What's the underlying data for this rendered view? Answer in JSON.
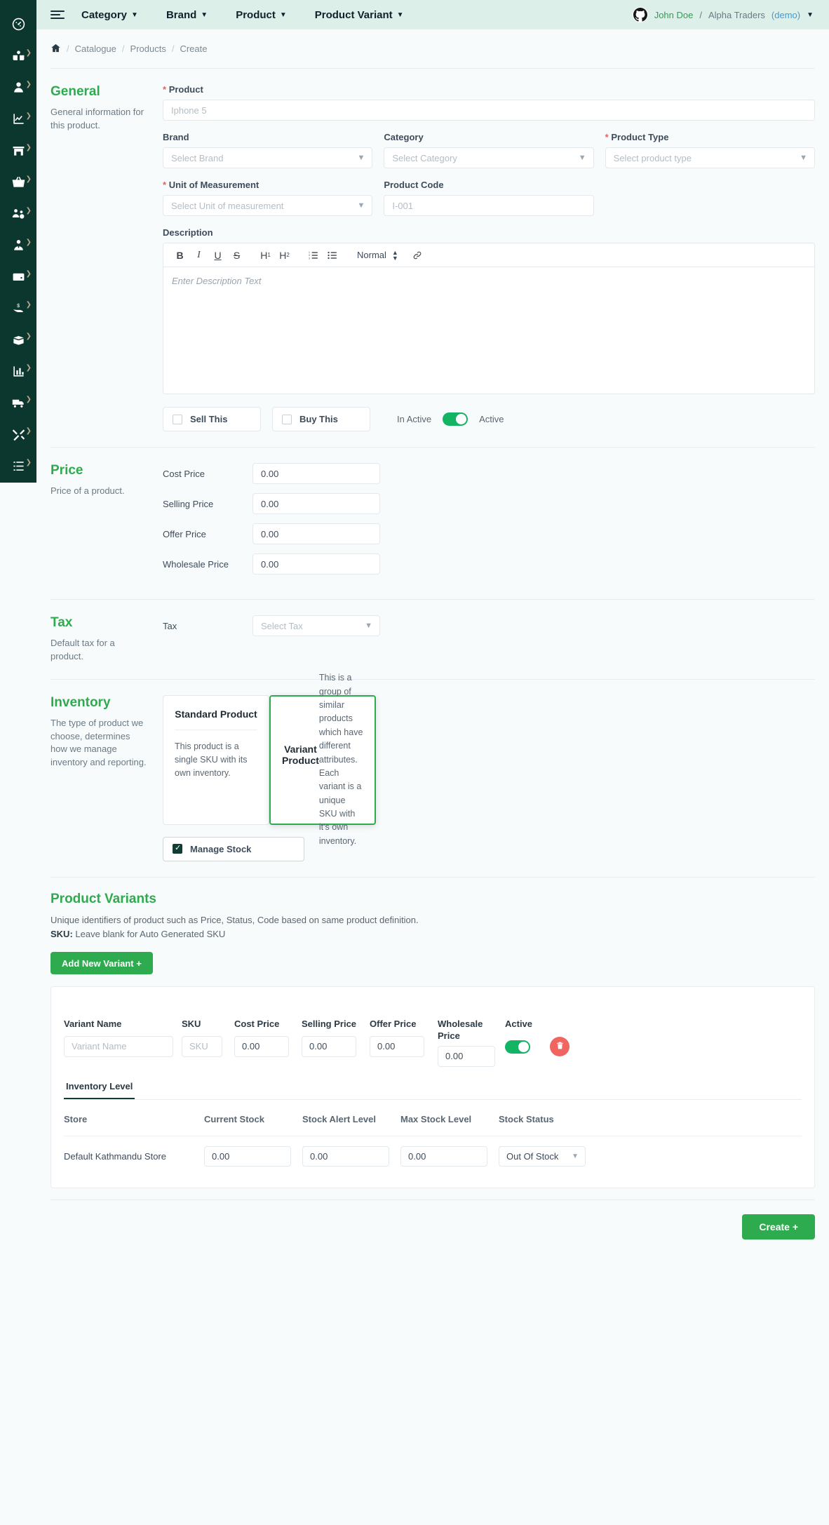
{
  "sidebar": {
    "items": [
      {
        "name": "dashboard",
        "icon": "gauge-icon",
        "has_caret": false
      },
      {
        "name": "catalogue",
        "icon": "book-user-icon",
        "has_caret": true
      },
      {
        "name": "customers",
        "icon": "user-icon",
        "has_caret": true
      },
      {
        "name": "reports",
        "icon": "chart-line-icon",
        "has_caret": true
      },
      {
        "name": "store",
        "icon": "store-icon",
        "has_caret": true
      },
      {
        "name": "purchase",
        "icon": "basket-icon",
        "has_caret": true
      },
      {
        "name": "user-management",
        "icon": "users-gear-icon",
        "has_caret": true
      },
      {
        "name": "employee",
        "icon": "employee-tie-icon",
        "has_caret": true
      },
      {
        "name": "accounts",
        "icon": "wallet-icon",
        "has_caret": true
      },
      {
        "name": "payments",
        "icon": "hand-dollar-icon",
        "has_caret": true
      },
      {
        "name": "inventory",
        "icon": "box-open-icon",
        "has_caret": true
      },
      {
        "name": "analytics",
        "icon": "bar-chart-icon",
        "has_caret": true
      },
      {
        "name": "delivery",
        "icon": "truck-icon",
        "has_caret": true
      },
      {
        "name": "tools",
        "icon": "tools-icon",
        "has_caret": true
      },
      {
        "name": "list",
        "icon": "list-check-icon",
        "has_caret": true
      }
    ]
  },
  "topbar": {
    "menu": [
      {
        "label": "Category"
      },
      {
        "label": "Brand"
      },
      {
        "label": "Product"
      },
      {
        "label": "Product Variant"
      }
    ],
    "user": {
      "avatar_icon": "github-icon",
      "name": "John Doe",
      "separator": "/",
      "company": "Alpha Traders",
      "demo": "(demo)"
    }
  },
  "breadcrumb": {
    "home_icon": "home-icon",
    "items": [
      "Catalogue",
      "Products",
      "Create"
    ],
    "separator": "/"
  },
  "general": {
    "title": "General",
    "desc": "General information for this product.",
    "product_label": "Product",
    "product_placeholder": "Iphone 5",
    "brand_label": "Brand",
    "brand_placeholder": "Select Brand",
    "category_label": "Category",
    "category_placeholder": "Select Category",
    "product_type_label": "Product Type",
    "product_type_placeholder": "Select product type",
    "uom_label": "Unit of Measurement",
    "uom_placeholder": "Select Unit of measurement",
    "product_code_label": "Product Code",
    "product_code_placeholder": "I-001",
    "description_label": "Description",
    "description_placeholder": "Enter Description Text",
    "toolbar": {
      "bold": "B",
      "italic": "I",
      "underline": "U",
      "strike": "S",
      "h1": "H",
      "h1_sub": "1",
      "h2": "H",
      "h2_sub": "2",
      "ordered_list_icon": "ordered-list-icon",
      "bullet_list_icon": "bullet-list-icon",
      "format_select": "Normal",
      "link_icon": "link-icon"
    },
    "sell_this": "Sell This",
    "buy_this": "Buy This",
    "inactive_label": "In Active",
    "active_label": "Active",
    "active_state": true
  },
  "price": {
    "title": "Price",
    "desc": "Price of a product.",
    "rows": [
      {
        "label": "Cost Price",
        "value": "0.00"
      },
      {
        "label": "Selling Price",
        "value": "0.00"
      },
      {
        "label": "Offer Price",
        "value": "0.00"
      },
      {
        "label": "Wholesale Price",
        "value": "0.00"
      }
    ]
  },
  "tax": {
    "title": "Tax",
    "desc": "Default tax for a product.",
    "label": "Tax",
    "placeholder": "Select  Tax"
  },
  "inventory": {
    "title": "Inventory",
    "desc": "The type of product we choose, determines how we manage inventory and reporting.",
    "cards": [
      {
        "title": "Standard Product",
        "text": "This product is a single SKU with its own inventory.",
        "selected": false
      },
      {
        "title": "Variant Product",
        "text": "This is a group of similar products which have different attributes. Each variant is a unique SKU with it's own inventory.",
        "selected": true
      }
    ],
    "manage_stock_label": "Manage Stock",
    "manage_stock_checked": true
  },
  "variants": {
    "title": "Product Variants",
    "desc": "Unique identifiers of product such as Price, Status, Code based on same product definition.",
    "sku_note_bold": "SKU:",
    "sku_note": " Leave blank for Auto Generated SKU",
    "add_button": "Add New Variant +",
    "columns": {
      "variant_name": "Variant Name",
      "sku": "SKU",
      "cost_price": "Cost Price",
      "selling_price": "Selling Price",
      "offer_price": "Offer Price",
      "wholesale_price": "Wholesale Price",
      "active": "Active"
    },
    "row": {
      "variant_name_placeholder": "Variant Name",
      "sku_placeholder": "SKU",
      "cost_price": "0.00",
      "selling_price": "0.00",
      "offer_price": "0.00",
      "wholesale_price": "0.00",
      "active": true,
      "delete_icon": "trash-icon"
    },
    "inventory_tab": "Inventory Level",
    "inv_columns": [
      "Store",
      "Current Stock",
      "Stock Alert Level",
      "Max Stock Level",
      "Stock Status"
    ],
    "inv_rows": [
      {
        "store": "Default Kathmandu Store",
        "current_stock": "0.00",
        "stock_alert_level": "0.00",
        "max_stock_level": "0.00",
        "stock_status": "Out Of Stock"
      }
    ]
  },
  "footer": {
    "create_button": "Create +"
  },
  "colors": {
    "sidebar_bg": "#0b372e",
    "topbar_bg": "#ddefe9",
    "accent_green": "#2fab4f",
    "toggle_green": "#13b463",
    "required_red": "#e8615f",
    "delete_red": "#f0655f",
    "page_bg": "#f7fbfb"
  }
}
